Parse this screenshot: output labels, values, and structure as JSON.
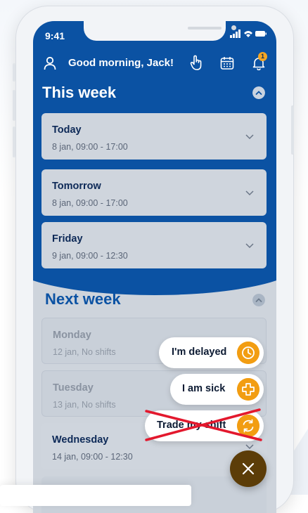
{
  "status_bar": {
    "time": "9:41"
  },
  "header": {
    "greeting": "Good morning, Jack!",
    "notification_count": "1"
  },
  "this_week": {
    "title": "This week",
    "items": [
      {
        "label": "Today",
        "detail": "8 jan, 09:00 - 17:00"
      },
      {
        "label": "Tomorrow",
        "detail": "8 jan, 09:00 - 17:00"
      },
      {
        "label": "Friday",
        "detail": "9 jan, 09:00 - 12:30"
      }
    ]
  },
  "next_week": {
    "title": "Next week",
    "items": [
      {
        "label": "Monday",
        "detail": "12 jan, No shifts"
      },
      {
        "label": "Tuesday",
        "detail": "13 jan, No shifts"
      },
      {
        "label": "Wednesday",
        "detail": "14 jan, 09:00 - 12:30"
      }
    ]
  },
  "actions": {
    "delayed": "I'm delayed",
    "sick": "I am sick",
    "trade": "Trade my shift"
  },
  "colors": {
    "primary_blue": "#0b52a3",
    "accent_orange": "#f29d12",
    "fab_brown": "#5c3d08",
    "strike_red": "#e3182d"
  },
  "icons": [
    "user-icon",
    "hand-icon",
    "calendar-icon",
    "bell-icon",
    "chevron-up-icon",
    "chevron-down-icon",
    "clock-icon",
    "plus-cross-icon",
    "swap-icon",
    "close-icon"
  ]
}
